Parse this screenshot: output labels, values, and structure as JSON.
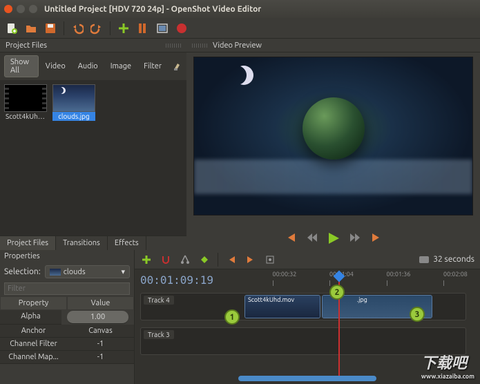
{
  "window": {
    "title": "Untitled Project [HDV 720 24p] - OpenShot Video Editor"
  },
  "panels": {
    "projectFiles": "Project Files",
    "videoPreview": "Video Preview",
    "properties": "Properties"
  },
  "fileTabs": {
    "showAll": "Show All",
    "video": "Video",
    "audio": "Audio",
    "image": "Image",
    "filter": "Filter"
  },
  "files": [
    {
      "name": "Scott4kUhd..."
    },
    {
      "name": "clouds.jpg"
    }
  ],
  "bottomTabs": {
    "projectFiles": "Project Files",
    "transitions": "Transitions",
    "effects": "Effects"
  },
  "properties": {
    "selectionLabel": "Selection:",
    "selectionValue": "clouds",
    "filterPlaceholder": "Filter",
    "headers": {
      "property": "Property",
      "value": "Value"
    },
    "rows": [
      {
        "prop": "Alpha",
        "val": "1.00"
      },
      {
        "prop": "Anchor",
        "val": "Canvas"
      },
      {
        "prop": "Channel Filter",
        "val": "-1"
      },
      {
        "prop": "Channel Map...",
        "val": "-1"
      }
    ]
  },
  "timeline": {
    "zoomLabel": "32 seconds",
    "timecode": "00:01:09:19",
    "ticks": [
      "00:00:32",
      "00:01:04",
      "00:01:36",
      "00:02:08"
    ],
    "tracks": [
      {
        "name": "Track 4"
      },
      {
        "name": "Track 3"
      }
    ],
    "clips": [
      {
        "name": "Scott4kUhd.mov"
      },
      {
        "name": ".jpg"
      }
    ],
    "markers": [
      "1",
      "2",
      "3"
    ]
  },
  "watermark": {
    "text": "下载吧",
    "url": "www.xiazaiba.com"
  },
  "icons": {
    "new": "new-file",
    "open": "open-folder",
    "save": "save",
    "undo": "undo",
    "redo": "redo",
    "add": "plus",
    "import": "import",
    "export": "export",
    "fullscreen": "fullscreen",
    "record": "record"
  }
}
